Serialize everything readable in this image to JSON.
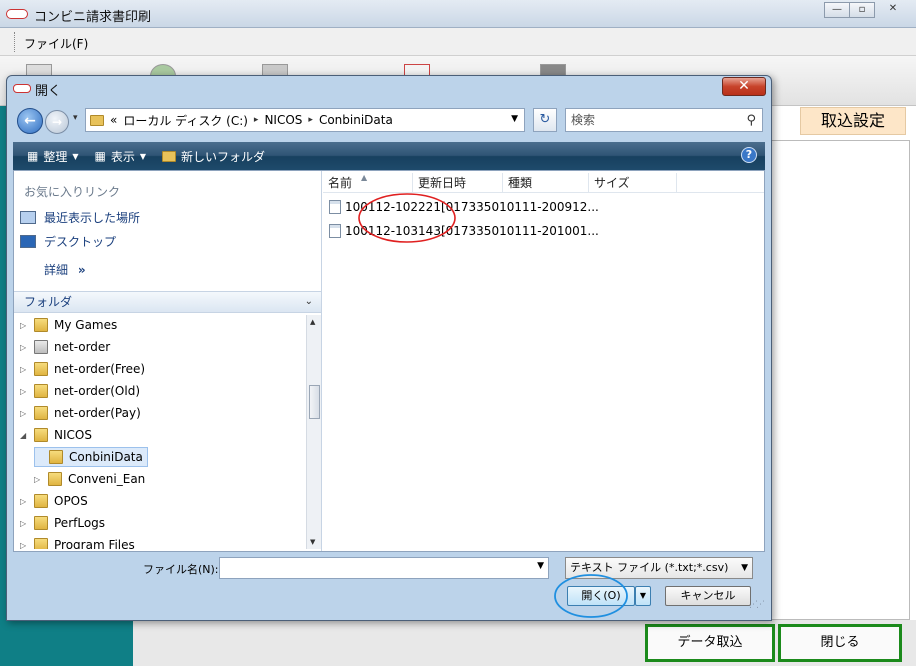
{
  "app": {
    "title": "コンビニ請求書印刷",
    "menu_file": "ファイル(F)",
    "section_label": "取込設定",
    "import_button": "データ取込",
    "close_button": "閉じる",
    "window_controls": [
      "minimize-icon",
      "restore-icon",
      "close-icon"
    ]
  },
  "dialog": {
    "title": "開く",
    "close_label": "✕",
    "address_prefix": "«",
    "address_path": [
      "ローカル ディスク (C:)",
      "NICOS",
      "ConbiniData"
    ],
    "search_placeholder": "検索",
    "commands": {
      "organize": "整理",
      "view": "表示",
      "new_folder": "新しいフォルダ"
    },
    "favorites": {
      "header": "お気に入りリンク",
      "items": [
        "最近表示した場所",
        "デスクトップ"
      ],
      "more": "詳細"
    },
    "folders": {
      "header": "フォルダ",
      "tree": [
        {
          "label": "My Games",
          "indent": 0,
          "expander": "▷"
        },
        {
          "label": "net-order",
          "indent": 0,
          "expander": "▷"
        },
        {
          "label": "net-order(Free)",
          "indent": 0,
          "expander": "▷"
        },
        {
          "label": "net-order(Old)",
          "indent": 0,
          "expander": "▷"
        },
        {
          "label": "net-order(Pay)",
          "indent": 0,
          "expander": "▷"
        },
        {
          "label": "NICOS",
          "indent": 0,
          "expander": "◢"
        },
        {
          "label": "ConbiniData",
          "indent": 1,
          "expander": "",
          "selected": true
        },
        {
          "label": "Conveni_Ean",
          "indent": 1,
          "expander": "▷"
        },
        {
          "label": "OPOS",
          "indent": 0,
          "expander": "▷"
        },
        {
          "label": "PerfLogs",
          "indent": 0,
          "expander": "▷"
        },
        {
          "label": "Program Files",
          "indent": 0,
          "expander": "▷"
        }
      ]
    },
    "columns": [
      "名前",
      "更新日時",
      "種類",
      "サイズ"
    ],
    "files": [
      {
        "name": "100112-102221[017335010111-200912..."
      },
      {
        "name": "100112-103143[017335010111-201001..."
      }
    ],
    "filename_label": "ファイル名(N):",
    "filename_value": "",
    "filetype": "テキスト ファイル (*.txt;*.csv)",
    "open_button": "開く(O)",
    "cancel_button": "キャンセル"
  },
  "colors": {
    "sidebar": "#0f7f86",
    "annotation_red": "#e02020",
    "annotation_blue": "#1f8fe0",
    "button_border_green": "#1b8a1b"
  }
}
